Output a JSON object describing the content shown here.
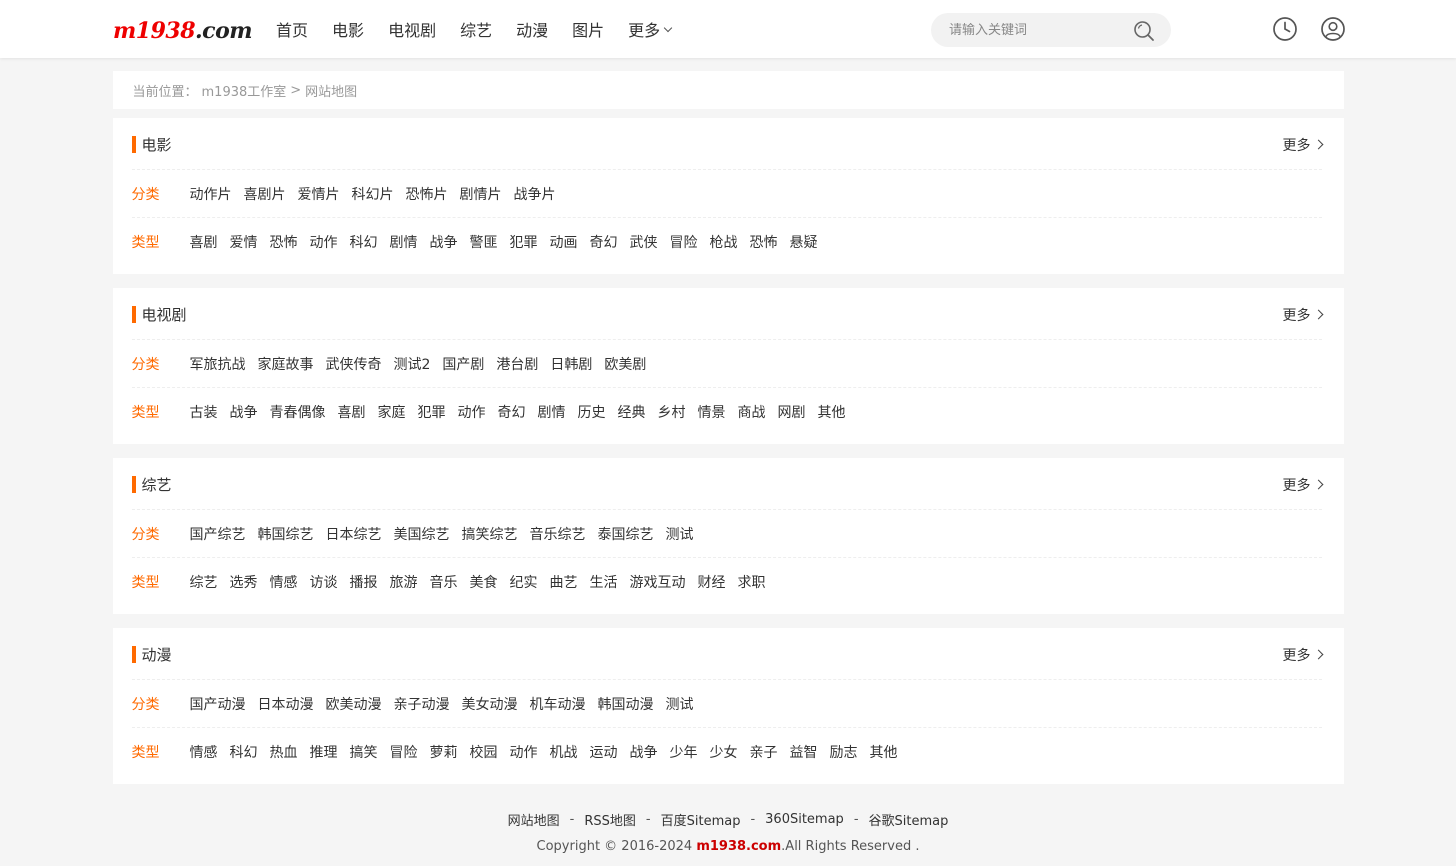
{
  "header": {
    "logo_main": "m1938",
    "logo_suffix": ".com",
    "nav": [
      "首页",
      "电影",
      "电视剧",
      "综艺",
      "动漫",
      "图片"
    ],
    "nav_more": "更多",
    "search_placeholder": "请输入关键词"
  },
  "breadcrumb": {
    "prefix": "当前位置：",
    "home": "m1938工作室",
    "sep": ">",
    "current": "网站地图"
  },
  "sections": [
    {
      "title": "电影",
      "more": "更多",
      "rows": [
        {
          "label": "分类",
          "tags": [
            "动作片",
            "喜剧片",
            "爱情片",
            "科幻片",
            "恐怖片",
            "剧情片",
            "战争片"
          ]
        },
        {
          "label": "类型",
          "tags": [
            "喜剧",
            "爱情",
            "恐怖",
            "动作",
            "科幻",
            "剧情",
            "战争",
            "警匪",
            "犯罪",
            "动画",
            "奇幻",
            "武侠",
            "冒险",
            "枪战",
            "恐怖",
            "悬疑"
          ]
        }
      ]
    },
    {
      "title": "电视剧",
      "more": "更多",
      "rows": [
        {
          "label": "分类",
          "tags": [
            "军旅抗战",
            "家庭故事",
            "武侠传奇",
            "测试2",
            "国产剧",
            "港台剧",
            "日韩剧",
            "欧美剧"
          ]
        },
        {
          "label": "类型",
          "tags": [
            "古装",
            "战争",
            "青春偶像",
            "喜剧",
            "家庭",
            "犯罪",
            "动作",
            "奇幻",
            "剧情",
            "历史",
            "经典",
            "乡村",
            "情景",
            "商战",
            "网剧",
            "其他"
          ]
        }
      ]
    },
    {
      "title": "综艺",
      "more": "更多",
      "rows": [
        {
          "label": "分类",
          "tags": [
            "国产综艺",
            "韩国综艺",
            "日本综艺",
            "美国综艺",
            "搞笑综艺",
            "音乐综艺",
            "泰国综艺",
            "测试"
          ]
        },
        {
          "label": "类型",
          "tags": [
            "综艺",
            "选秀",
            "情感",
            "访谈",
            "播报",
            "旅游",
            "音乐",
            "美食",
            "纪实",
            "曲艺",
            "生活",
            "游戏互动",
            "财经",
            "求职"
          ]
        }
      ]
    },
    {
      "title": "动漫",
      "more": "更多",
      "rows": [
        {
          "label": "分类",
          "tags": [
            "国产动漫",
            "日本动漫",
            "欧美动漫",
            "亲子动漫",
            "美女动漫",
            "机车动漫",
            "韩国动漫",
            "测试"
          ]
        },
        {
          "label": "类型",
          "tags": [
            "情感",
            "科幻",
            "热血",
            "推理",
            "搞笑",
            "冒险",
            "萝莉",
            "校园",
            "动作",
            "机战",
            "运动",
            "战争",
            "少年",
            "少女",
            "亲子",
            "益智",
            "励志",
            "其他"
          ]
        }
      ]
    }
  ],
  "footer": {
    "links": [
      "网站地图",
      "RSS地图",
      "百度Sitemap",
      "360Sitemap",
      "谷歌Sitemap"
    ],
    "sep": "-",
    "copyright_prefix": "Copyright © 2016-2024",
    "copyright_brand": "m1938.com",
    "copyright_suffix": ".All Rights Reserved ."
  },
  "colors": {
    "accent": "#ff6a00",
    "brand_red": "#e00000",
    "background": "#f5f5f5"
  },
  "icons": {
    "search": "search-icon",
    "history": "clock-icon",
    "user": "user-icon"
  }
}
